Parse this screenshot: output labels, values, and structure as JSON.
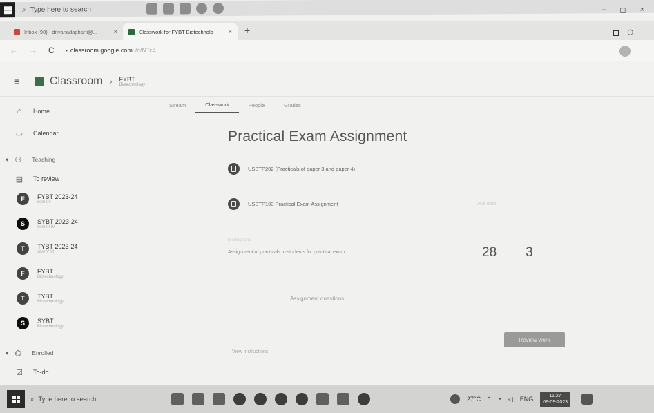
{
  "top_taskbar": {
    "search_placeholder": "Type here to search"
  },
  "browser": {
    "tabs": [
      {
        "label": "Inbox (98) - dnyanadagharti@...",
        "icon": "mail-icon"
      },
      {
        "label": "Classwork for FYBT Biotechnolo",
        "icon": "classroom-icon"
      }
    ],
    "new_tab": "+",
    "url": "classroom.google.com",
    "url_suffix": "/c/NTc4...",
    "window_controls": {
      "minimize": "–",
      "maximize": "◻",
      "close": "×"
    }
  },
  "header": {
    "app_name": "Classroom",
    "course_name": "FYBT",
    "course_sub": "Biotechnology"
  },
  "sidebar": {
    "home": "Home",
    "calendar": "Calendar",
    "teaching": "Teaching",
    "to_review": "To review",
    "courses": [
      {
        "initial": "F",
        "name": "FYBT 2023-24",
        "sub": "sem I II"
      },
      {
        "initial": "S",
        "name": "SYBT 2023-24",
        "sub": "sem III IV"
      },
      {
        "initial": "T",
        "name": "TYBT 2023-24",
        "sub": "sem V VI"
      },
      {
        "initial": "F",
        "name": "FYBT",
        "sub": "Biotechnology"
      },
      {
        "initial": "T",
        "name": "TYBT",
        "sub": "Biotechnology"
      },
      {
        "initial": "S",
        "name": "SYBT",
        "sub": "Biotechnology"
      }
    ],
    "enrolled": "Enrolled",
    "todo": "To-do"
  },
  "main_tabs": {
    "stream": "Stream",
    "classwork": "Classwork",
    "people": "People",
    "grades": "Grades"
  },
  "assignment": {
    "title": "Practical Exam Assignment",
    "item1": "USBTP202 (Practicals of paper 3 and paper 4)",
    "item2": "USBTP103 Practical Exam Assignment",
    "item2_meta": "Due date",
    "desc_label": "Instructions",
    "desc": "Assignment of practicals to students for practical exam",
    "turned_in": "28",
    "assigned": "3",
    "answer_label": "Assignment questions",
    "review_button": "Review work",
    "view_link": "View instructions"
  },
  "bottom_taskbar": {
    "search_placeholder": "Type here to search",
    "weather": "27°C",
    "lang": "ENG",
    "time": "11:27",
    "date": "09-09-2023"
  }
}
